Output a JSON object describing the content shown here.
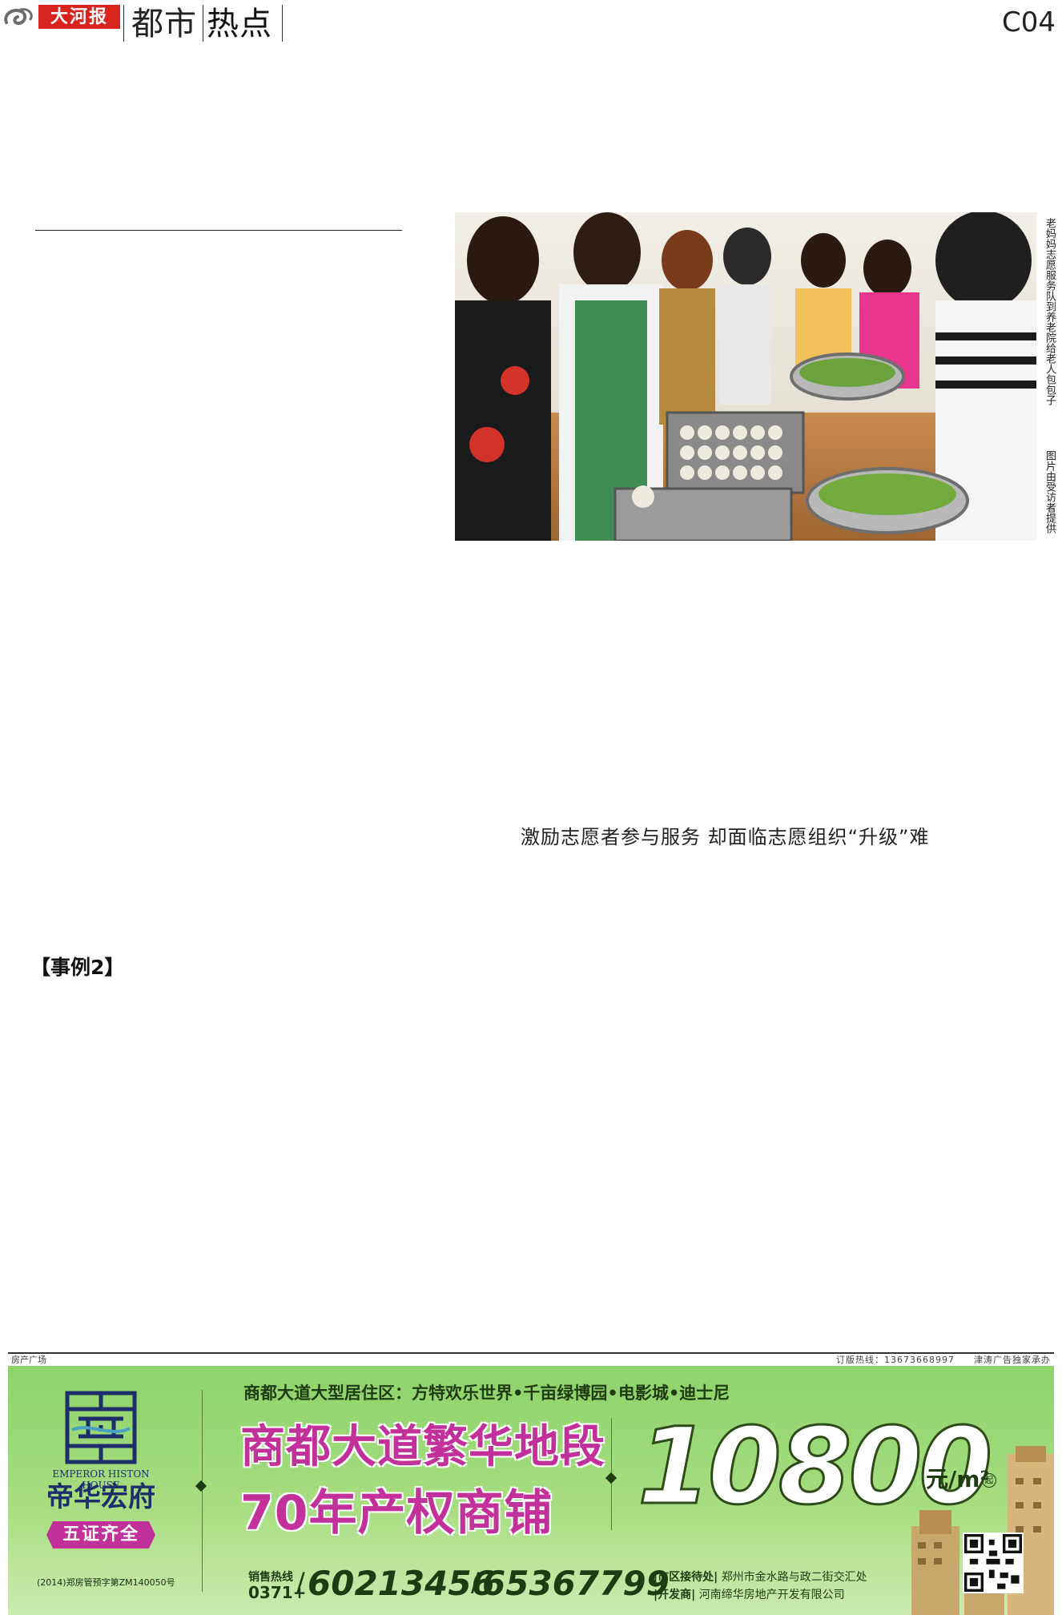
{
  "header": {
    "brand": "大河报",
    "section_part1": "都市",
    "section_part2": "热点",
    "page_number": "C04"
  },
  "photo": {
    "caption": "老妈妈志愿服务队到养老院给老人包包子",
    "credit": "图片由受访者提供"
  },
  "article": {
    "subheading": "激励志愿者参与服务 却面临志愿组织“升级”难",
    "case_label": "【事例2】"
  },
  "ad": {
    "strip_left": "房产广场",
    "strip_right": "订版热线：13673668997　　津涛广告独家承办",
    "brand_en": "EMPEROR HISTON HOUSE",
    "brand_cn": "帝华宏府",
    "badge": "五证齐全",
    "permit": "(2014)郑房管预字第ZM140050号",
    "tagline": "商都大道大型居住区：方特欢乐世界•千亩绿博园•电影城•迪士尼",
    "headline1": "商都大道繁华地段",
    "headline2": "70年产权商铺",
    "price": "10800",
    "unit": "元/m²",
    "unit_suffix": "起",
    "hotline_label": "销售热线",
    "area_code": "0371+",
    "phone1": "60213456",
    "phone2": "65367799",
    "address_label": "|市区接待处|",
    "address": "郑州市金水路与政二街交汇处",
    "developer_label": "|开发商|",
    "developer": "河南缔华房地产开发有限公司"
  },
  "colors": {
    "brand_red": "#d8231f",
    "ad_magenta": "#c2309a",
    "ad_green": "#8dd36a",
    "ad_navy": "#1d2f6b"
  }
}
